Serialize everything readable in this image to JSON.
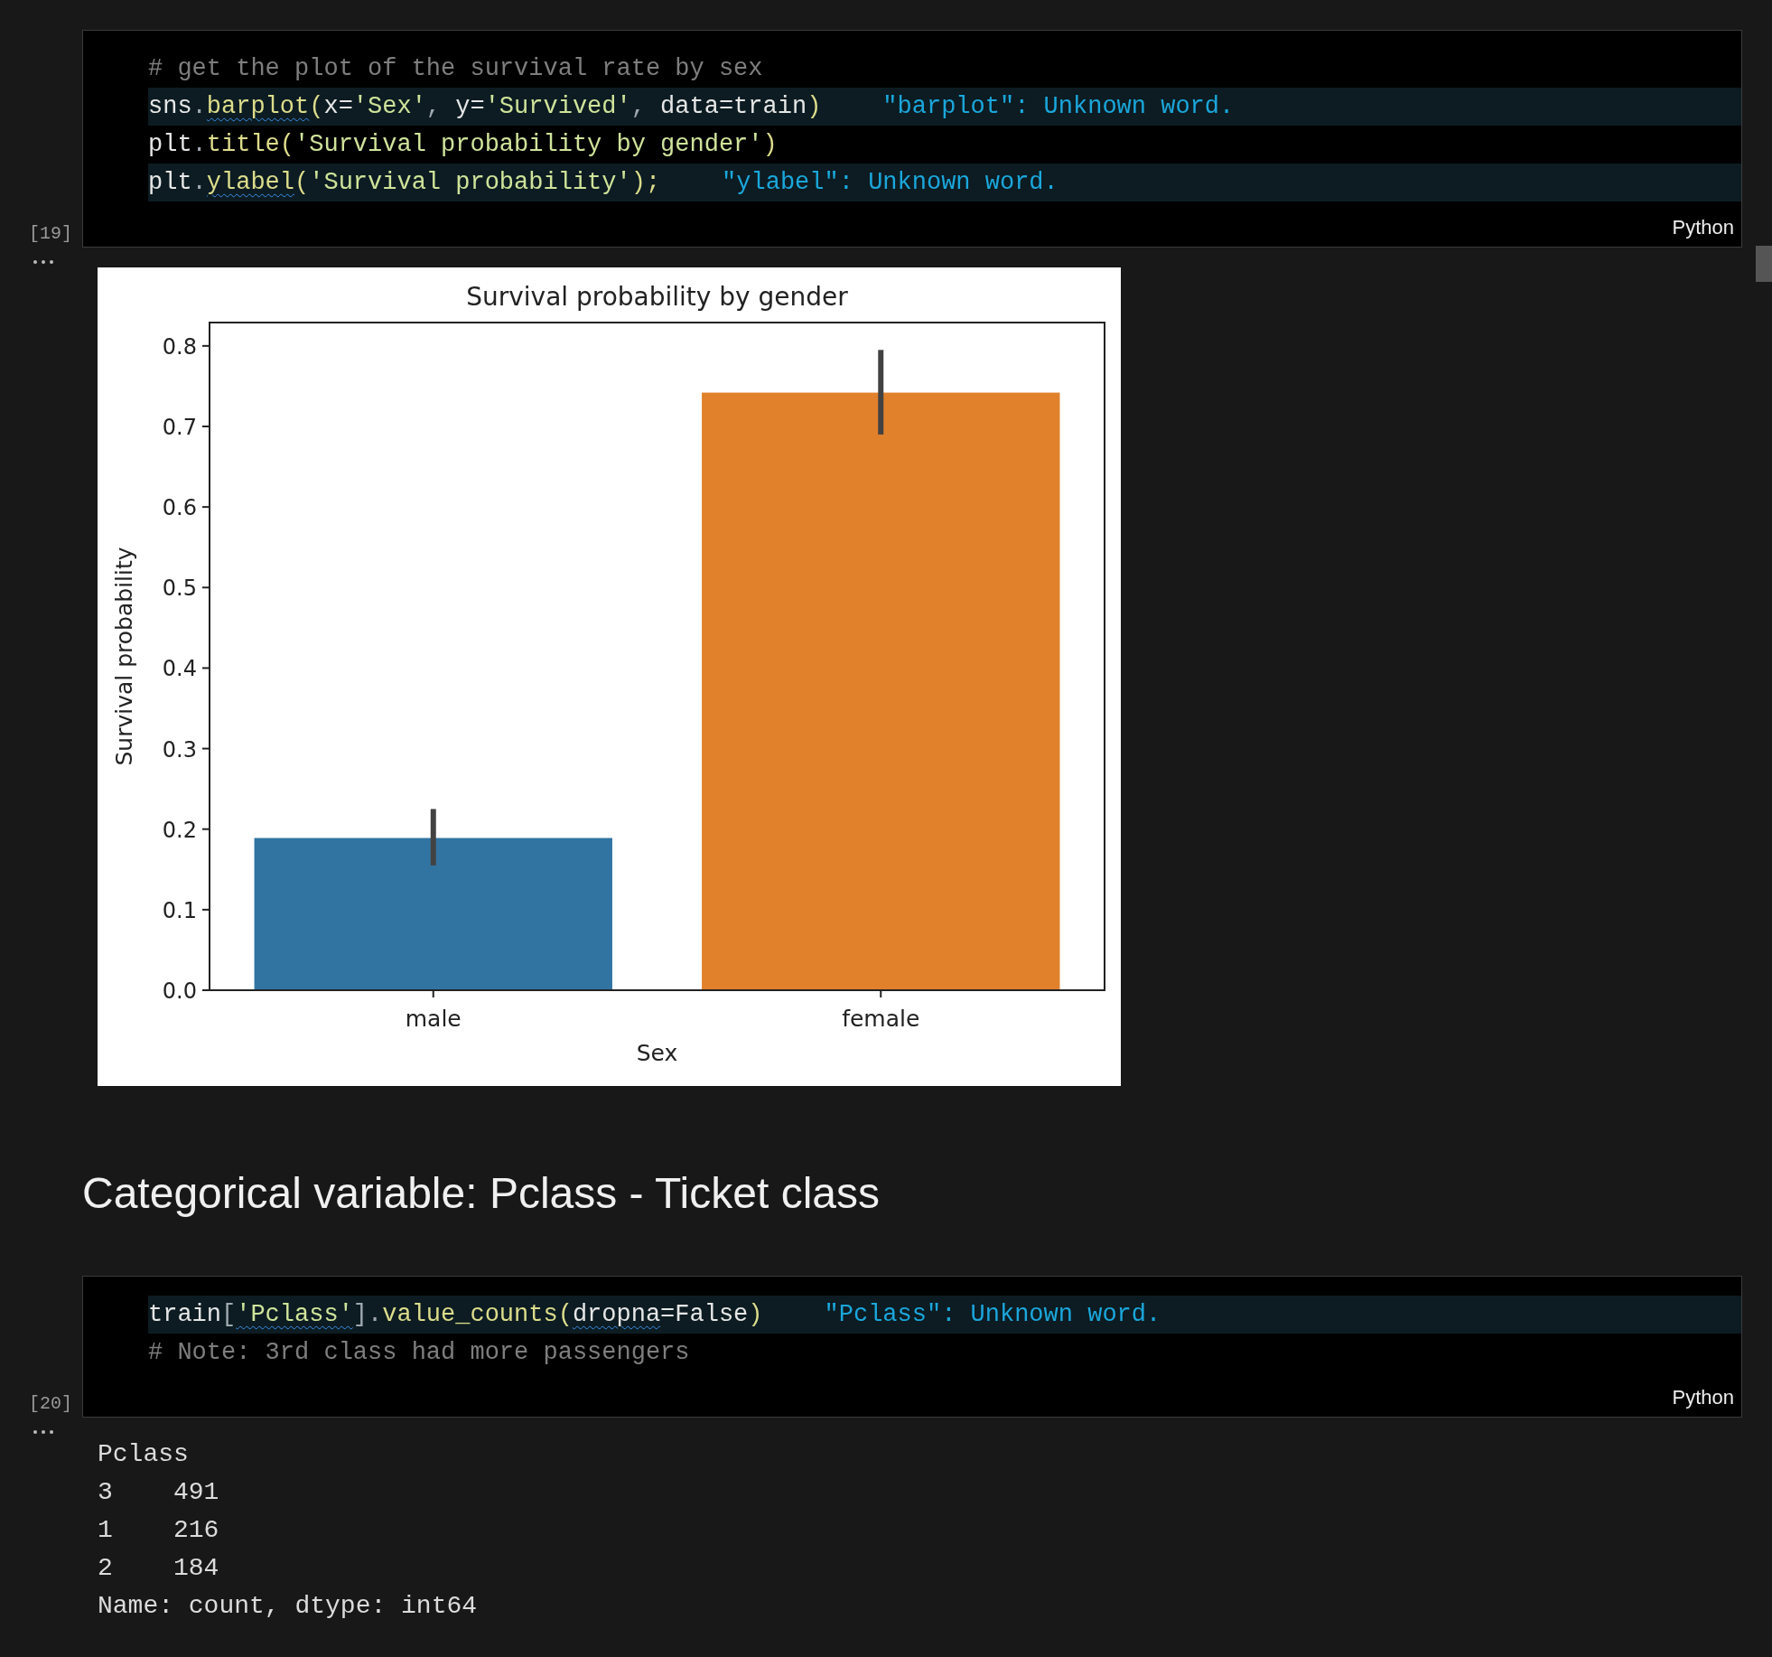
{
  "cells": [
    {
      "kind": "code",
      "execution_count": "[19]",
      "language": "Python",
      "lines": [
        {
          "highlighted": false,
          "tokens": [
            {
              "text": "# get the plot of the survival rate by sex",
              "kind": "comment",
              "squiggle": false
            }
          ]
        },
        {
          "highlighted": true,
          "hint": "\"barplot\": Unknown word.",
          "tokens": [
            {
              "text": "sns",
              "kind": "plain",
              "squiggle": false
            },
            {
              "text": ".",
              "kind": "punct",
              "squiggle": false
            },
            {
              "text": "barplot",
              "kind": "function",
              "squiggle": true
            },
            {
              "text": "(",
              "kind": "function",
              "squiggle": false
            },
            {
              "text": "x=",
              "kind": "plain",
              "squiggle": false
            },
            {
              "text": "'Sex'",
              "kind": "string",
              "squiggle": false
            },
            {
              "text": ", ",
              "kind": "punct",
              "squiggle": false
            },
            {
              "text": "y=",
              "kind": "plain",
              "squiggle": false
            },
            {
              "text": "'Survived'",
              "kind": "string",
              "squiggle": false
            },
            {
              "text": ", ",
              "kind": "punct",
              "squiggle": false
            },
            {
              "text": "data=train",
              "kind": "plain",
              "squiggle": false
            },
            {
              "text": ")",
              "kind": "function",
              "squiggle": false
            }
          ]
        },
        {
          "highlighted": false,
          "tokens": [
            {
              "text": "plt",
              "kind": "plain",
              "squiggle": false
            },
            {
              "text": ".",
              "kind": "punct",
              "squiggle": false
            },
            {
              "text": "title",
              "kind": "function",
              "squiggle": false
            },
            {
              "text": "(",
              "kind": "function",
              "squiggle": false
            },
            {
              "text": "'Survival probability by gender'",
              "kind": "string",
              "squiggle": false
            },
            {
              "text": ")",
              "kind": "function",
              "squiggle": false
            }
          ]
        },
        {
          "highlighted": true,
          "hint": "\"ylabel\": Unknown word.",
          "tokens": [
            {
              "text": "plt",
              "kind": "plain",
              "squiggle": false
            },
            {
              "text": ".",
              "kind": "punct",
              "squiggle": false
            },
            {
              "text": "ylabel",
              "kind": "function",
              "squiggle": true
            },
            {
              "text": "(",
              "kind": "function",
              "squiggle": false
            },
            {
              "text": "'Survival probability'",
              "kind": "string",
              "squiggle": false
            },
            {
              "text": ");",
              "kind": "function",
              "squiggle": false
            }
          ]
        }
      ],
      "output": {
        "kind": "chart",
        "chart_data": {
          "type": "bar",
          "title": "Survival probability by gender",
          "xlabel": "Sex",
          "ylabel": "Survival probability",
          "categories": [
            "male",
            "female"
          ],
          "series": [
            {
              "color": "#3274a1",
              "values": [
                0.189,
                null
              ],
              "errors": [
                [
                  0.155,
                  0.225
                ],
                null
              ]
            },
            {
              "color": "#e1812c",
              "values": [
                null,
                0.742
              ],
              "errors": [
                null,
                [
                  0.69,
                  0.795
                ]
              ]
            }
          ],
          "ylim": [
            0,
            0.829
          ],
          "yticks": [
            {
              "value": 0,
              "label": "0.0"
            },
            {
              "value": 0.1,
              "label": "0.1"
            },
            {
              "value": 0.2,
              "label": "0.2"
            },
            {
              "value": 0.3,
              "label": "0.3"
            },
            {
              "value": 0.4,
              "label": "0.4"
            },
            {
              "value": 0.5,
              "label": "0.5"
            },
            {
              "value": 0.6,
              "label": "0.6"
            },
            {
              "value": 0.7,
              "label": "0.7"
            },
            {
              "value": 0.8,
              "label": "0.8"
            }
          ]
        }
      }
    },
    {
      "kind": "markdown",
      "heading": "Categorical variable: Pclass - Ticket class"
    },
    {
      "kind": "code",
      "execution_count": "[20]",
      "language": "Python",
      "lines": [
        {
          "highlighted": true,
          "hint": "\"Pclass\": Unknown word.",
          "tokens": [
            {
              "text": "train",
              "kind": "plain",
              "squiggle": false
            },
            {
              "text": "[",
              "kind": "punct",
              "squiggle": false
            },
            {
              "text": "'Pclass'",
              "kind": "string",
              "squiggle": true
            },
            {
              "text": "].",
              "kind": "punct",
              "squiggle": false
            },
            {
              "text": "value_counts",
              "kind": "function",
              "squiggle": false
            },
            {
              "text": "(",
              "kind": "function",
              "squiggle": false
            },
            {
              "text": "dropna",
              "kind": "plain",
              "squiggle": true
            },
            {
              "text": "=False",
              "kind": "plain",
              "squiggle": false
            },
            {
              "text": ")",
              "kind": "function",
              "squiggle": false
            }
          ]
        },
        {
          "highlighted": false,
          "tokens": [
            {
              "text": "# Note: 3rd class had more passengers",
              "kind": "comment",
              "squiggle": false
            }
          ]
        }
      ],
      "output": {
        "kind": "text",
        "lines": [
          "Pclass",
          "3    491",
          "1    216",
          "2    184",
          "Name: count, dtype: int64"
        ]
      }
    }
  ]
}
